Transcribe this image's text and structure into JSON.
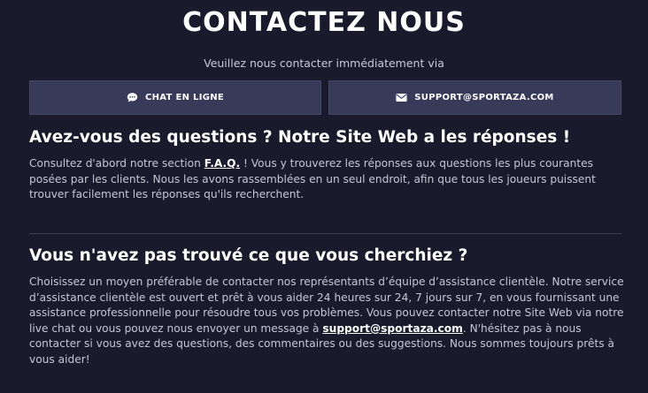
{
  "header": {
    "title": "CONTACTEZ NOUS",
    "subtitle": "Veuillez nous contacter immédiatement via"
  },
  "buttons": {
    "chat_label": "CHAT EN LIGNE",
    "chat_icon": "chat-bubble-icon",
    "email_label": "SUPPORT@SPORTAZA.COM",
    "email_icon": "envelope-icon"
  },
  "faq_section": {
    "heading": "Avez-vous des questions ? Notre Site Web a les réponses !",
    "text_before_link": "Consultez d'abord notre section ",
    "link": "F.A.Q.",
    "text_after_link": " ! Vous y trouverez les réponses aux questions les plus courantes posées par les clients. Nous les avons rassemblées en un seul endroit, afin que tous les joueurs puissent trouver facilement les réponses qu'ils recherchent."
  },
  "not_found_section": {
    "heading": "Vous n'avez pas trouvé ce que vous cherchiez ?",
    "text_before_link": "Choisissez un moyen préférable de contacter nos représentants d’équipe d’assistance clientèle. Notre service d’assistance clientèle est ouvert et prêt à vous aider 24 heures sur 24, 7 jours sur 7, en vous fournissant une assistance professionnelle pour résoudre tous vos problèmes. Vous pouvez contacter notre Site Web via notre live chat ou vous pouvez nous envoyer un message à ",
    "link": "support@sportaza.com",
    "text_after_link": ". N'hésitez pas à nous contacter si vous avez des questions, des commentaires ou des suggestions. Nous sommes toujours prêts à vous aider!"
  },
  "colors": {
    "background": "#1b1a2c",
    "button": "#383a5a",
    "text": "#c6c6d3",
    "heading": "#ffffff"
  }
}
